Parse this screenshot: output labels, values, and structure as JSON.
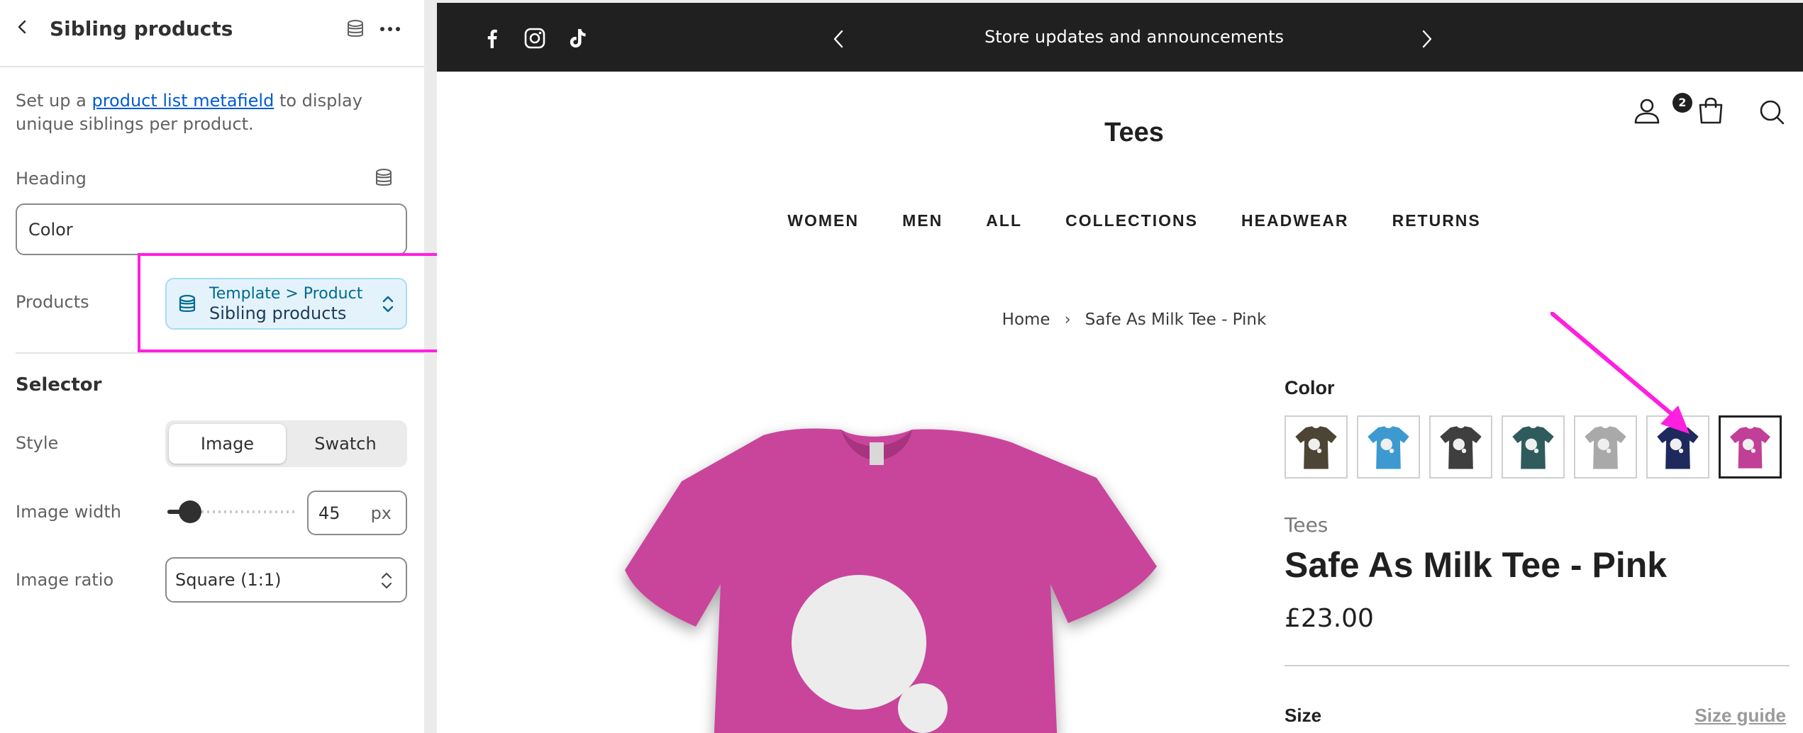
{
  "panel": {
    "title": "Sibling products",
    "description_prefix": "Set up a ",
    "description_link": "product list metafield",
    "description_suffix": " to display unique siblings per product.",
    "heading_label": "Heading",
    "heading_value": "Color",
    "products_label": "Products",
    "products_source_path": "Template > Product",
    "products_source_value": "Sibling products",
    "selector_title": "Selector",
    "style_label": "Style",
    "style_options": [
      "Image",
      "Swatch"
    ],
    "style_selected": "Image",
    "image_width_label": "Image width",
    "image_width_value": "45",
    "image_width_unit": "px",
    "image_ratio_label": "Image ratio",
    "image_ratio_value": "Square (1:1)",
    "icons": [
      "chevron-left-icon",
      "database-icon",
      "more-horizontal-icon",
      "select-chevron-icon"
    ],
    "colors": {
      "accent_link": "#005bd3",
      "annotation": "#ff1fdf",
      "dynamic_source_bg": "#e4f3fb"
    }
  },
  "preview": {
    "announcement": "Store updates and announcements",
    "store_name": "Tees",
    "cart_count": "2",
    "nav": [
      "WOMEN",
      "MEN",
      "ALL",
      "COLLECTIONS",
      "HEADWEAR",
      "RETURNS"
    ],
    "breadcrumb": [
      "Home",
      "Safe As Milk Tee - Pink"
    ],
    "color_label": "Color",
    "swatch_colors": [
      "#4c4535",
      "#3d9ad1",
      "#3f3f3f",
      "#2f5b5c",
      "#a9a9a9",
      "#1e2a5e",
      "#c23f97"
    ],
    "swatch_selected_index": 6,
    "vendor": "Tees",
    "product_title": "Safe As Milk Tee - Pink",
    "price": "£23.00",
    "size_label": "Size",
    "size_guide": "Size guide",
    "shirt_color": "#c9449b",
    "icons": [
      "facebook-icon",
      "instagram-icon",
      "tiktok-icon",
      "chevron-left-icon",
      "chevron-right-icon",
      "account-icon",
      "cart-icon",
      "search-icon"
    ]
  }
}
